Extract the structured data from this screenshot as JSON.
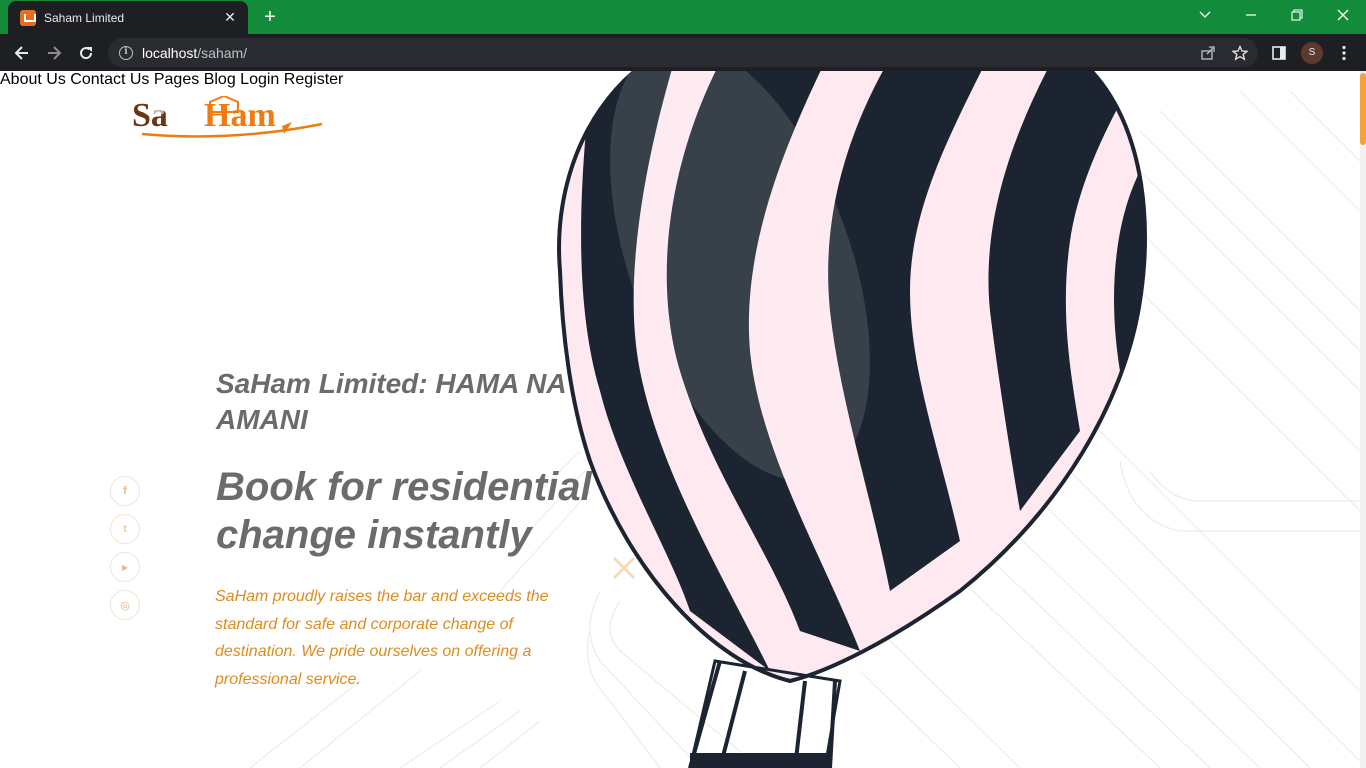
{
  "browser": {
    "tab_title": "Saham Limited",
    "url_host": "localhost",
    "url_path": "/saham/",
    "profile_initial": "S",
    "frame_color": "#128c3b"
  },
  "header": {
    "logo_text": "SaHam",
    "nav": [
      {
        "label": "About Us"
      },
      {
        "label": "Contact Us"
      },
      {
        "label": "Pages"
      },
      {
        "label": "Blog"
      },
      {
        "label": "Login"
      },
      {
        "label": "Register"
      }
    ]
  },
  "hero": {
    "kicker_line1": "SaHam Limited: HAMA NA",
    "kicker_line2": "AMANI",
    "title_line1": "Book for residential",
    "title_line2": "change instantly",
    "text": "SaHam proudly raises the bar and exceeds the standard for safe and corporate change of destination. We pride ourselves on offering a professional service."
  },
  "social": [
    {
      "icon": "facebook-icon",
      "glyph": "f"
    },
    {
      "icon": "twitter-icon",
      "glyph": "t"
    },
    {
      "icon": "youtube-icon",
      "glyph": "▶"
    },
    {
      "icon": "instagram-icon",
      "glyph": "◎"
    }
  ],
  "colors": {
    "accent": "#e08b1d",
    "heading": "#6b6b6b",
    "balloon_dark": "#1b2430",
    "balloon_light": "#fde9ef"
  }
}
